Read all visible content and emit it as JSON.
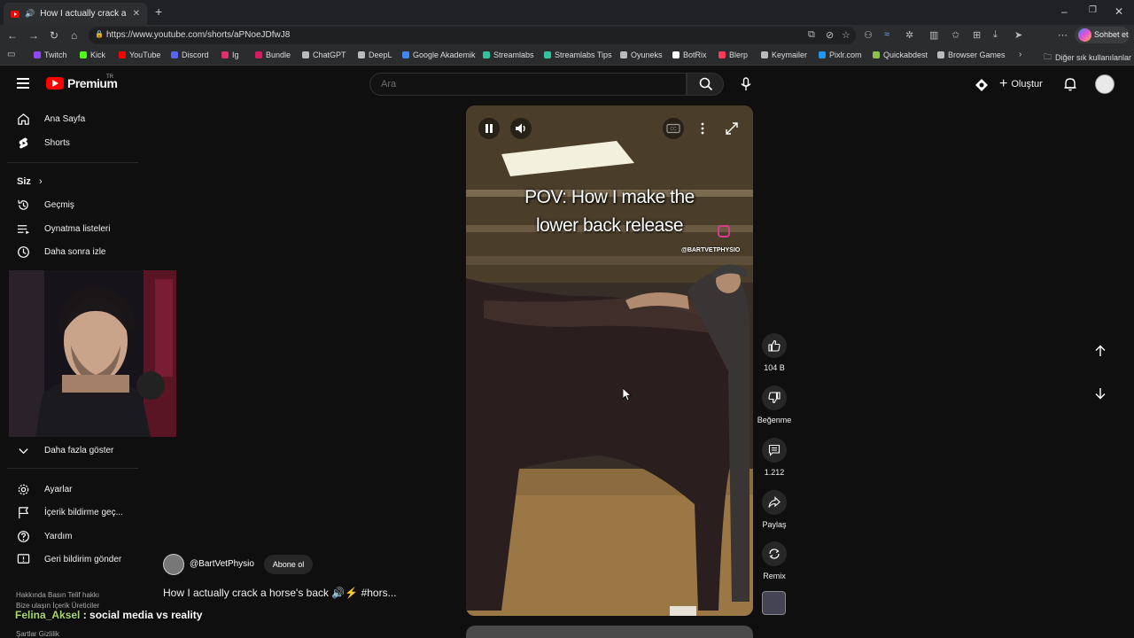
{
  "browser": {
    "tab_title": "How I actually crack a horse's back",
    "url": "https://www.youtube.com/shorts/aPNoeJDfwJ8",
    "copilot_label": "Sohbet et",
    "bookmarks": [
      "Twitch",
      "Kick",
      "YouTube",
      "Discord",
      "Ig",
      "Bundle",
      "ChatGPT",
      "DeepL",
      "Google Akademik",
      "Streamlabs",
      "Streamlabs Tips",
      "Oyuneks",
      "BotRix",
      "Blerp",
      "Keymailer",
      "Pixlr.com",
      "Quickabdest",
      "Browser Games"
    ],
    "bookmarks_other": "Diğer sık kullanılanlar",
    "bookmark_colors": [
      "#9146ff",
      "#53fc18",
      "#ff0000",
      "#5865f2",
      "#e1306c",
      "#d81b60",
      "#bbbbbb",
      "#bbbbbb",
      "#4285f4",
      "#31c3a2",
      "#31c3a2",
      "#bbbbbb",
      "#ffffff",
      "#ff3b5c",
      "#bbbbbb",
      "#2196f3",
      "#8bc34a",
      "#bbbbbb"
    ]
  },
  "header": {
    "logo_text": "Premium",
    "logo_sup": "TR",
    "search_placeholder": "Ara",
    "create_label": "Oluştur"
  },
  "sidebar": {
    "main": [
      {
        "label": "Ana Sayfa",
        "icon": "home-icon"
      },
      {
        "label": "Shorts",
        "icon": "shorts-icon"
      }
    ],
    "you_label": "Siz",
    "you_items": [
      {
        "label": "Geçmiş",
        "icon": "history-icon"
      },
      {
        "label": "Oynatma listeleri",
        "icon": "playlist-icon"
      },
      {
        "label": "Daha sonra izle",
        "icon": "clock-icon"
      }
    ],
    "show_more": "Daha fazla göster",
    "bottom_items": [
      {
        "label": "Ayarlar",
        "icon": "gear-icon"
      },
      {
        "label": "İçerik bildirme geç...",
        "icon": "flag-icon"
      },
      {
        "label": "Yardım",
        "icon": "help-icon"
      },
      {
        "label": "Geri bildirim gönder",
        "icon": "feedback-icon"
      }
    ],
    "footer_line1": "Hakkında   Basın   Telif hakkı",
    "footer_line2": "Bize ulaşın   İçerik Üreticiler",
    "footer_line3": "Şartlar   Gizlilik"
  },
  "video": {
    "overlay_line1": "POV: How I make the",
    "overlay_line2": "lower back release",
    "handle": "@BARTVETPHYSIO"
  },
  "actions": {
    "likes": "104 B",
    "dislike_label": "Beğenme",
    "comments": "1.212",
    "share_label": "Paylaş",
    "remix_label": "Remix"
  },
  "channel": {
    "name": "@BartVetPhysio",
    "subscribe_label": "Abone ol",
    "title": "How I actually crack a horse's back 🔊⚡ #hors..."
  },
  "stream_caption": {
    "name": "Felina_Aksel",
    "text": " : social media vs reality"
  }
}
